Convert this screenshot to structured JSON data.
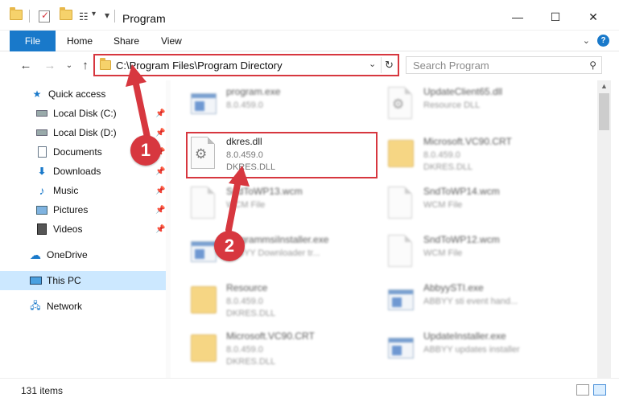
{
  "window": {
    "title": "Program",
    "minimize": "—",
    "maximize": "☐",
    "close": "✕"
  },
  "ribbon": {
    "tabs": [
      "File",
      "Home",
      "Share",
      "View"
    ]
  },
  "address": {
    "path": "C:\\Program Files\\Program Directory",
    "search_placeholder": "Search Program"
  },
  "sidebar": {
    "items": [
      {
        "label": "Quick access",
        "icon": "star-icon"
      },
      {
        "label": "Local Disk (C:)",
        "icon": "drive-icon"
      },
      {
        "label": "Local Disk (D:)",
        "icon": "drive-icon"
      },
      {
        "label": "Documents",
        "icon": "documents-icon"
      },
      {
        "label": "Downloads",
        "icon": "download-icon"
      },
      {
        "label": "Music",
        "icon": "music-icon"
      },
      {
        "label": "Pictures",
        "icon": "pictures-icon"
      },
      {
        "label": "Videos",
        "icon": "videos-icon"
      },
      {
        "label": "OneDrive",
        "icon": "cloud-icon"
      },
      {
        "label": "This PC",
        "icon": "computer-icon"
      },
      {
        "label": "Network",
        "icon": "network-icon"
      }
    ]
  },
  "files": [
    {
      "name": "program.exe",
      "line2": "8.0.459.0",
      "line3": "",
      "icon": "exe",
      "blurred": true
    },
    {
      "name": "UpdateClient65.dll",
      "line2": "Resource DLL",
      "line3": "",
      "icon": "dll",
      "blurred": true
    },
    {
      "name": "dkres.dll",
      "line2": "8.0.459.0",
      "line3": "DKRES.DLL",
      "icon": "dll",
      "blurred": false
    },
    {
      "name": "Microsoft.VC90.CRT",
      "line2": "8.0.459.0",
      "line3": "DKRES.DLL",
      "icon": "folder",
      "blurred": true
    },
    {
      "name": "SndToWP13.wcm",
      "line2": "WCM File",
      "line3": "",
      "icon": "doc",
      "blurred": true
    },
    {
      "name": "SndToWP14.wcm",
      "line2": "WCM File",
      "line3": "",
      "icon": "doc",
      "blurred": true
    },
    {
      "name": "programmsiInstaller.exe",
      "line2": "ABBYY Downloader tr...",
      "line3": "",
      "icon": "exe",
      "blurred": true
    },
    {
      "name": "SndToWP12.wcm",
      "line2": "WCM File",
      "line3": "",
      "icon": "doc",
      "blurred": true
    },
    {
      "name": "Resource",
      "line2": "8.0.459.0",
      "line3": "DKRES.DLL",
      "icon": "folder",
      "blurred": true
    },
    {
      "name": "AbbyySTI.exe",
      "line2": "ABBYY sti event hand...",
      "line3": "",
      "icon": "exe",
      "blurred": true
    },
    {
      "name": "Microsoft.VC90.CRT",
      "line2": "8.0.459.0",
      "line3": "DKRES.DLL",
      "icon": "folder",
      "blurred": true
    },
    {
      "name": "UpdateInstaller.exe",
      "line2": "ABBYY updates installer",
      "line3": "",
      "icon": "exe",
      "blurred": true
    }
  ],
  "status": {
    "item_count": "131 items"
  },
  "callouts": [
    "1",
    "2"
  ],
  "colors": {
    "accent": "#1979ca",
    "highlight": "#d7373f",
    "selected": "#cce8ff"
  }
}
